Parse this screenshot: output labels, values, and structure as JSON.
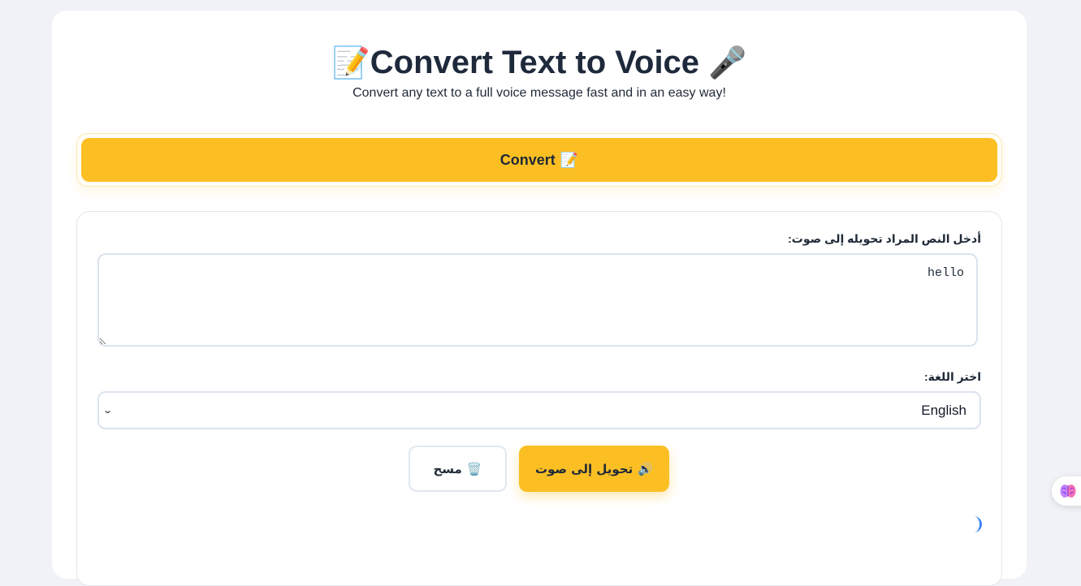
{
  "header": {
    "title_emoji_left": "📝",
    "title": "Convert Text to Voice",
    "title_emoji_right": "🎤",
    "subtitle": "Convert any text to a full voice message fast and in an easy way!"
  },
  "convert_button": {
    "label": "Convert",
    "emoji": "📝"
  },
  "form": {
    "text_label": "أدخل النص المراد تحويله إلى صوت:",
    "text_value": "hello",
    "language_label": "اختر اللغة:",
    "language_selected": "English",
    "clear_button": "مسح",
    "clear_emoji": "🗑️",
    "speak_button": "تحويل إلى صوت",
    "speak_emoji": "🔊"
  },
  "colors": {
    "accent": "#fbbf24",
    "background": "#f0f2f7",
    "text": "#1e293b"
  },
  "icons": {
    "floating": "brain-icon",
    "select": "chevron-down-icon"
  }
}
